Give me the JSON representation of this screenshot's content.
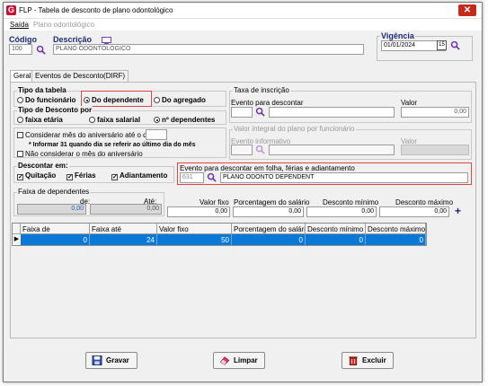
{
  "window": {
    "title": "FLP - Tabela de desconto de plano odontológico",
    "close": "✕"
  },
  "menu": {
    "exit": "Saída",
    "plan": "Plano odontológico"
  },
  "header": {
    "code_label": "Código",
    "code_value": "100",
    "desc_label": "Descrição",
    "desc_value": "PLANO ODONTOLOGICO",
    "validity_label": "Vigência",
    "validity_value": "01/01/2024"
  },
  "tabs": [
    "Geral",
    "Eventos de Desconto(DIRF)"
  ],
  "tipo_tabela": {
    "label": "Tipo da tabela",
    "opt1": "Do funcionário",
    "opt2": "Do dependente",
    "opt3": "Do agregado"
  },
  "tipo_desconto": {
    "label": "Tipo de Desconto por",
    "opt1": "faixa etária",
    "opt2": "faixa salarial",
    "opt3": "nº dependentes"
  },
  "aniversario": {
    "opt1": "Considerar mês do aniversário até o dia",
    "note": "* Informar 31 quando dia se referir ao último dia do mês",
    "opt2": "Não considerar o mês do aniversário"
  },
  "descontar": {
    "label": "Descontar em:",
    "opt1": "Quitação",
    "opt2": "Férias",
    "opt3": "Adiantamento"
  },
  "taxa": {
    "label": "Taxa de inscrição",
    "event_label": "Evento para descontar",
    "value_label": "Valor",
    "value": "0,00"
  },
  "valor_integral": {
    "label": "Valor integral do plano por funcionário",
    "event_label": "Evento informativo",
    "value_label": "Valor"
  },
  "evento_folha": {
    "label": "Evento para descontar em folha, férias e adiantamento",
    "code": "631",
    "desc": "PLANO ODONTO DEPENDENT"
  },
  "faixa": {
    "label": "Faixa de dependentes",
    "de_label": "de:",
    "ate_label": "Até:",
    "de_value": "0,00",
    "ate_value": "0,00",
    "valor_fixo_label": "Valor fixo",
    "valor_fixo": "0,00",
    "perc_label": "Porcentagem do salário",
    "perc": "0,00",
    "min_label": "Desconto mínimo",
    "min": "0,00",
    "max_label": "Desconto máximo",
    "max": "0,00",
    "add": "+"
  },
  "grid": {
    "headers": [
      "Faixa de",
      "Faixa até",
      "Valor fixo",
      "Porcentagem do salário",
      "Desconto mínimo",
      "Desconto máximo"
    ],
    "row": [
      "0",
      "24",
      "50",
      "0",
      "0",
      "0"
    ]
  },
  "buttons": {
    "save": "Gravar",
    "clear": "Limpar",
    "delete": "Excluir"
  }
}
